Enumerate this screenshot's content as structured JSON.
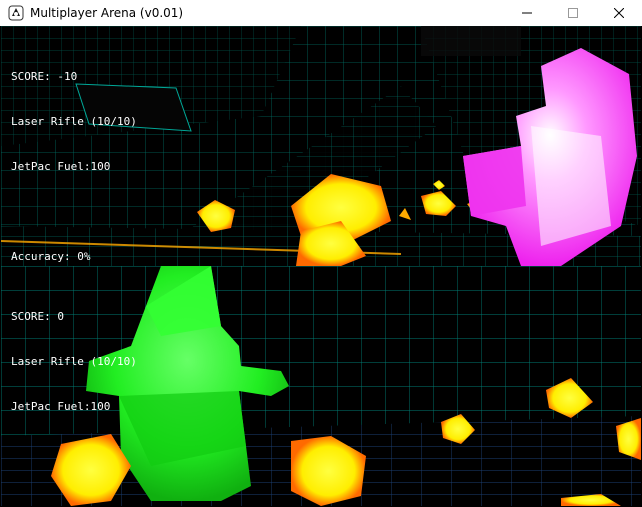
{
  "window": {
    "title": "Multiplayer Arena (v0.01)",
    "controls": {
      "minimize_icon": "minimize-icon",
      "maximize_icon": "maximize-icon",
      "close_icon": "close-icon"
    }
  },
  "player1": {
    "score": "SCORE: -10",
    "weapon": "Laser Rifle (10/10)",
    "fuel": "JetPac Fuel:100",
    "accuracy": "Accuracy: 0%",
    "opponent_color": "#ff33ff"
  },
  "player2": {
    "score": "SCORE: 0",
    "weapon": "Laser Rifle (10/10)",
    "fuel": "JetPac Fuel:100",
    "opponent_color": "#22ff22"
  },
  "colors": {
    "grid": "#00ccbb",
    "powerup": "#ffee00",
    "powerup_glow": "#ff6600",
    "hud_text": "#ffffff"
  }
}
